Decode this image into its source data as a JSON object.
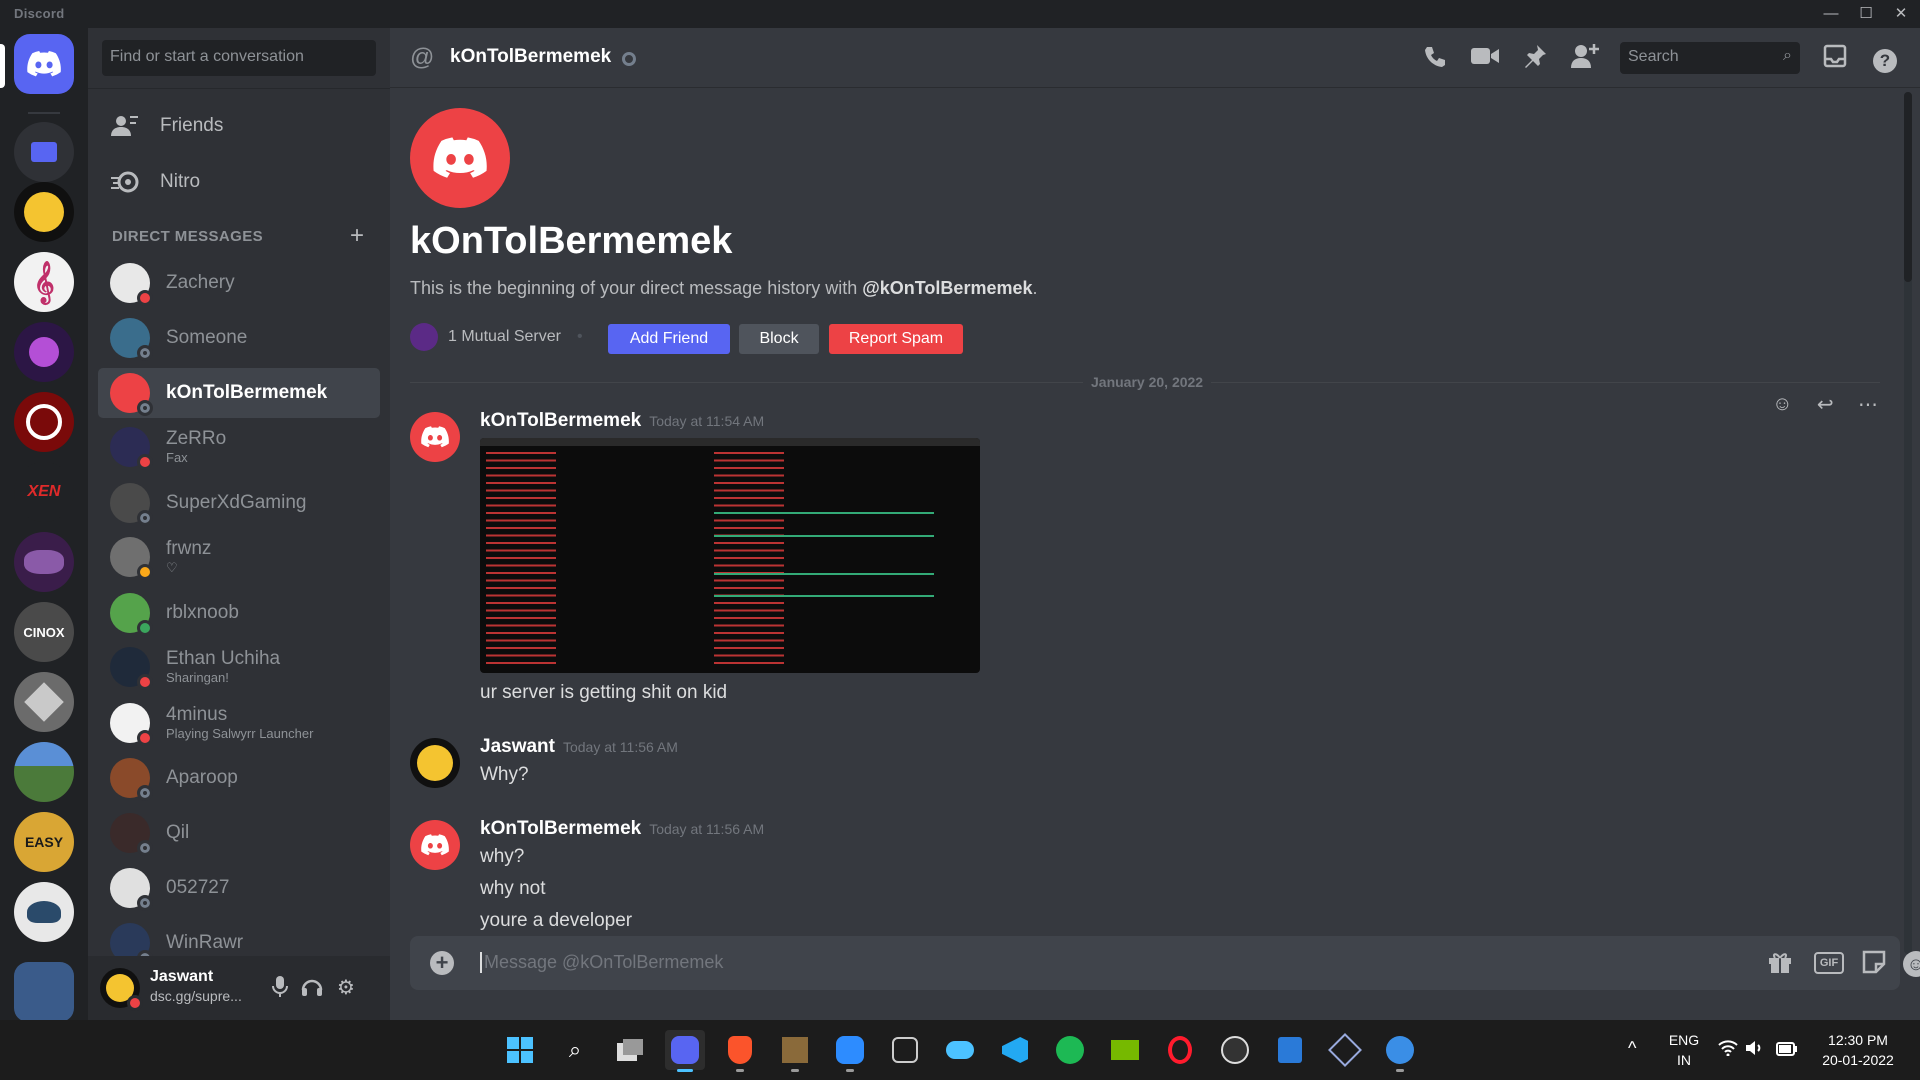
{
  "window": {
    "brand": "Discord",
    "controls": [
      "—",
      "☐",
      "✕"
    ]
  },
  "rail": {
    "servers": [
      {
        "name": "home",
        "color": "#5865f2",
        "text": ""
      },
      {
        "name": "folder",
        "color": "#2f3136",
        "text": ""
      },
      {
        "name": "server-marshmello",
        "color": "#101010",
        "text": ""
      },
      {
        "name": "server-music",
        "color": "#f2f2f2",
        "text": "♪"
      },
      {
        "name": "server-purple",
        "color": "#2c1645",
        "text": ""
      },
      {
        "name": "server-red",
        "color": "#7a0a0a",
        "text": ""
      },
      {
        "name": "server-xen",
        "color": "#202225",
        "text": "XEN"
      },
      {
        "name": "server-dark",
        "color": "#3a1d4a",
        "text": ""
      },
      {
        "name": "server-cinox",
        "color": "#4a4a4a",
        "text": "CINOX"
      },
      {
        "name": "server-aetherix",
        "color": "#6b6b6b",
        "text": ""
      },
      {
        "name": "server-landscape",
        "color": "#4b7a3a",
        "text": ""
      },
      {
        "name": "server-easy-vanilla",
        "color": "#d9a634",
        "text": "EASY"
      },
      {
        "name": "server-bird",
        "color": "#e8e8e8",
        "text": ""
      },
      {
        "name": "server-lifesteal",
        "color": "#3a5b8a",
        "text": ""
      }
    ]
  },
  "sidebar": {
    "search_placeholder": "Find or start a conversation",
    "nav": [
      {
        "label": "Friends"
      },
      {
        "label": "Nitro"
      }
    ],
    "dm_header": "DIRECT MESSAGES",
    "dms": [
      {
        "name": "Zachery",
        "sub": "",
        "status": "dnd",
        "color": "#e8e8e8"
      },
      {
        "name": "Someone",
        "sub": "",
        "status": "off",
        "color": "#3a6d8c"
      },
      {
        "name": "kOnTolBermemek",
        "sub": "",
        "status": "off",
        "color": "#ed4245"
      },
      {
        "name": "ZeRRo",
        "sub": "Fax",
        "status": "dnd",
        "color": "#2c2c54"
      },
      {
        "name": "SuperXdGaming",
        "sub": "",
        "status": "off",
        "color": "#4a4a4a"
      },
      {
        "name": "frwnz",
        "sub": "♡",
        "status": "idle",
        "color": "#6f6f6f"
      },
      {
        "name": "rblxnoob",
        "sub": "",
        "status": "on",
        "color": "#55a34b"
      },
      {
        "name": "Ethan Uchiha",
        "sub": "Sharingan!",
        "status": "dnd",
        "color": "#1f2a3a"
      },
      {
        "name": "4minus",
        "sub": "Playing Salwyrr Launcher",
        "status": "dnd",
        "color": "#f2f2f2"
      },
      {
        "name": "Aparoop",
        "sub": "",
        "status": "off",
        "color": "#8a4a2a"
      },
      {
        "name": "Qil",
        "sub": "",
        "status": "off",
        "color": "#3a2a2a"
      },
      {
        "name": "052727",
        "sub": "",
        "status": "off",
        "color": "#e0e0e0"
      },
      {
        "name": "WinRawr",
        "sub": "",
        "status": "off",
        "color": "#2a3a5a"
      }
    ]
  },
  "user": {
    "name": "Jaswant",
    "sub": "dsc.gg/supre..."
  },
  "header": {
    "title": "kOnTolBermemek",
    "search_placeholder": "Search"
  },
  "intro": {
    "name": "kOnTolBermemek",
    "text_prefix": "This is the beginning of your direct message history with ",
    "handle": "@kOnTolBermemek",
    "text_suffix": ".",
    "mutual": "1 Mutual Server",
    "add_friend": "Add Friend",
    "block": "Block",
    "report_spam": "Report Spam"
  },
  "date_divider": "January 20, 2022",
  "messages": [
    {
      "author": "kOnTolBermemek",
      "time": "Today at 11:54 AM",
      "lines": [
        "ur server is getting shit on kid"
      ]
    },
    {
      "author": "Jaswant",
      "time": "Today at 11:56 AM",
      "lines": [
        "Why?"
      ]
    },
    {
      "author": "kOnTolBermemek",
      "time": "Today at 11:56 AM",
      "lines": [
        "why?",
        "why not",
        "youre a developer"
      ]
    }
  ],
  "composer": {
    "placeholder": "Message @kOnTolBermemek",
    "gif": "GIF"
  },
  "taskbar": {
    "lang_top": "ENG",
    "lang_bottom": "IN",
    "time": "12:30 PM",
    "date": "20-01-2022"
  },
  "colors": {
    "blurple": "#5865f2",
    "red": "#ed4245",
    "green": "#3ba55d",
    "bg_chat": "#36393f",
    "bg_sidebar": "#2f3136"
  }
}
